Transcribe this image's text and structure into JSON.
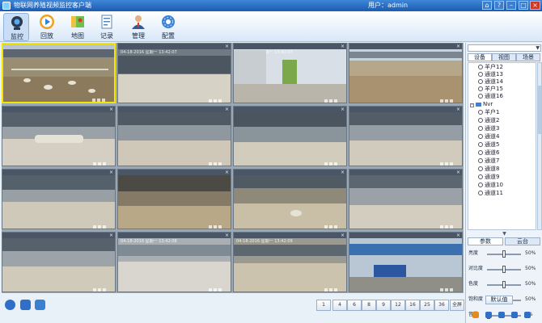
{
  "titlebar": {
    "title": "物联网养殖视频监控客户端",
    "user_label": "用户：admin"
  },
  "toolbar": {
    "items": [
      {
        "label": "监控",
        "icon": "camera-icon"
      },
      {
        "label": "回放",
        "icon": "playback-icon"
      },
      {
        "label": "地图",
        "icon": "map-icon"
      },
      {
        "label": "记录",
        "icon": "log-icon"
      },
      {
        "label": "管理",
        "icon": "admin-icon"
      },
      {
        "label": "配置",
        "icon": "settings-icon"
      }
    ]
  },
  "osd": [
    "04-18-2016 星期一 13:42:07",
    "04-18-2016 星期一 13:42:08",
    "04-18-2016 星期一 13:42:07",
    "04-18-2016 星期一 13:42:09"
  ],
  "split_buttons": [
    "1",
    "4",
    "6",
    "8",
    "9",
    "12",
    "16",
    "25",
    "36",
    "全屏"
  ],
  "right_panel": {
    "tabs": [
      "设备",
      "视图",
      "场景"
    ],
    "tree": [
      {
        "label": "羊户12",
        "level": 2
      },
      {
        "label": "通道13",
        "level": 2
      },
      {
        "label": "通道14",
        "level": 2
      },
      {
        "label": "羊户15",
        "level": 2
      },
      {
        "label": "通道16",
        "level": 2
      },
      {
        "label": "Nvr",
        "level": 1
      },
      {
        "label": "羊户1",
        "level": 2
      },
      {
        "label": "通道2",
        "level": 2
      },
      {
        "label": "通道3",
        "level": 2
      },
      {
        "label": "通道4",
        "level": 2
      },
      {
        "label": "通道5",
        "level": 2
      },
      {
        "label": "通道6",
        "level": 2
      },
      {
        "label": "通道7",
        "level": 2
      },
      {
        "label": "通道8",
        "level": 2
      },
      {
        "label": "通道9",
        "level": 2
      },
      {
        "label": "通道10",
        "level": 2
      },
      {
        "label": "通道11",
        "level": 2
      }
    ],
    "control_tabs": [
      "参数",
      "云台"
    ],
    "sliders": [
      {
        "label": "亮度",
        "value": "50%"
      },
      {
        "label": "对比度",
        "value": "50%"
      },
      {
        "label": "色度",
        "value": "50%"
      },
      {
        "label": "饱和度",
        "value": "50%"
      },
      {
        "label": "音量",
        "value": "0%"
      }
    ],
    "default_button": "默认值"
  }
}
